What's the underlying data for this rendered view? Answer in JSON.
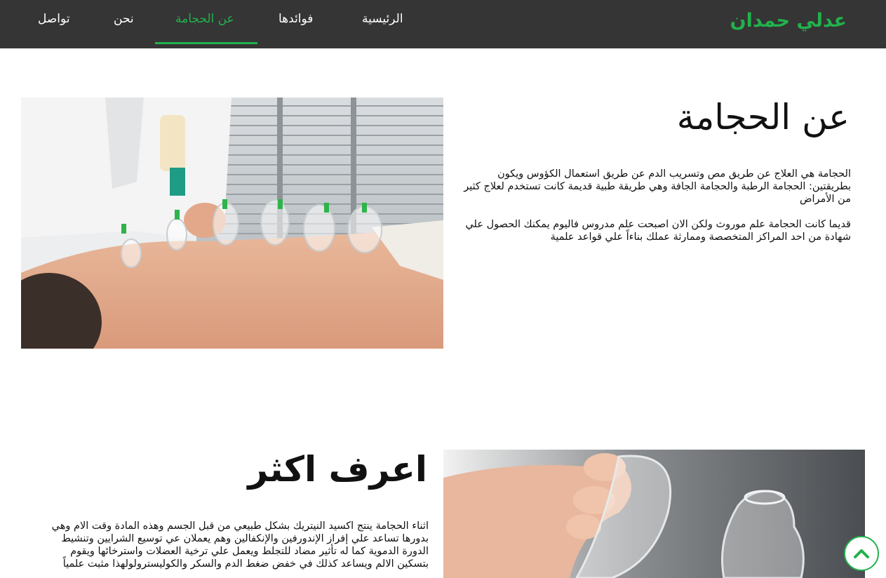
{
  "nav": {
    "brand": "عدلي حمدان",
    "links": [
      {
        "label": "الرئيسية"
      },
      {
        "label": "فوائدها"
      },
      {
        "label": "عن الحجامة"
      },
      {
        "label": "نحن"
      },
      {
        "label": "تواصل"
      }
    ],
    "active_index": 2
  },
  "about": {
    "title": "عن الحجامة",
    "paragraph_1": "الحجامة هي العلاج عن طريق مص وتسريب الدم عن طريق استعمال الكؤوس ويكون بطريقتين: الحجامة الرطبة والحجامة الجافة وهي طريقة طبية قديمة كانت تستخدم لعلاج كثير من الأمراض",
    "paragraph_2": "قديما كانت الحجامة علم موروث ولكن الان اصبحت علم مدروس فاليوم يمكنك الحصول علي شهادة من احد المراكز المتخصصة وممارثة عملك بناءاً علي قواعد علمية"
  },
  "more": {
    "title": "اعرف اكثر",
    "paragraph": "اثناء الحجامة ينتج اكسيد النيتريك بشكل طبيعي من قبل الجسم وهذه المادة وقت الام وهي بدورها تساعد علي إفراز الإندورفين والإنكفالين وهم يعملان عي توسيع الشرايين وتنشيط الدورة الدموية كما له تأثير مضاد للتجلط ويعمل علي ترخية العضلات واسترخائها ويقوم بتسكين الالم ويساعد كذلك في خفض ضغط الدم والسكر والكوليسترولولهذا مثبت علمياً"
  },
  "icons": {
    "to_top": "chevron-up-icon"
  },
  "colors": {
    "accent": "#21b24c",
    "navbar": "#353535"
  }
}
